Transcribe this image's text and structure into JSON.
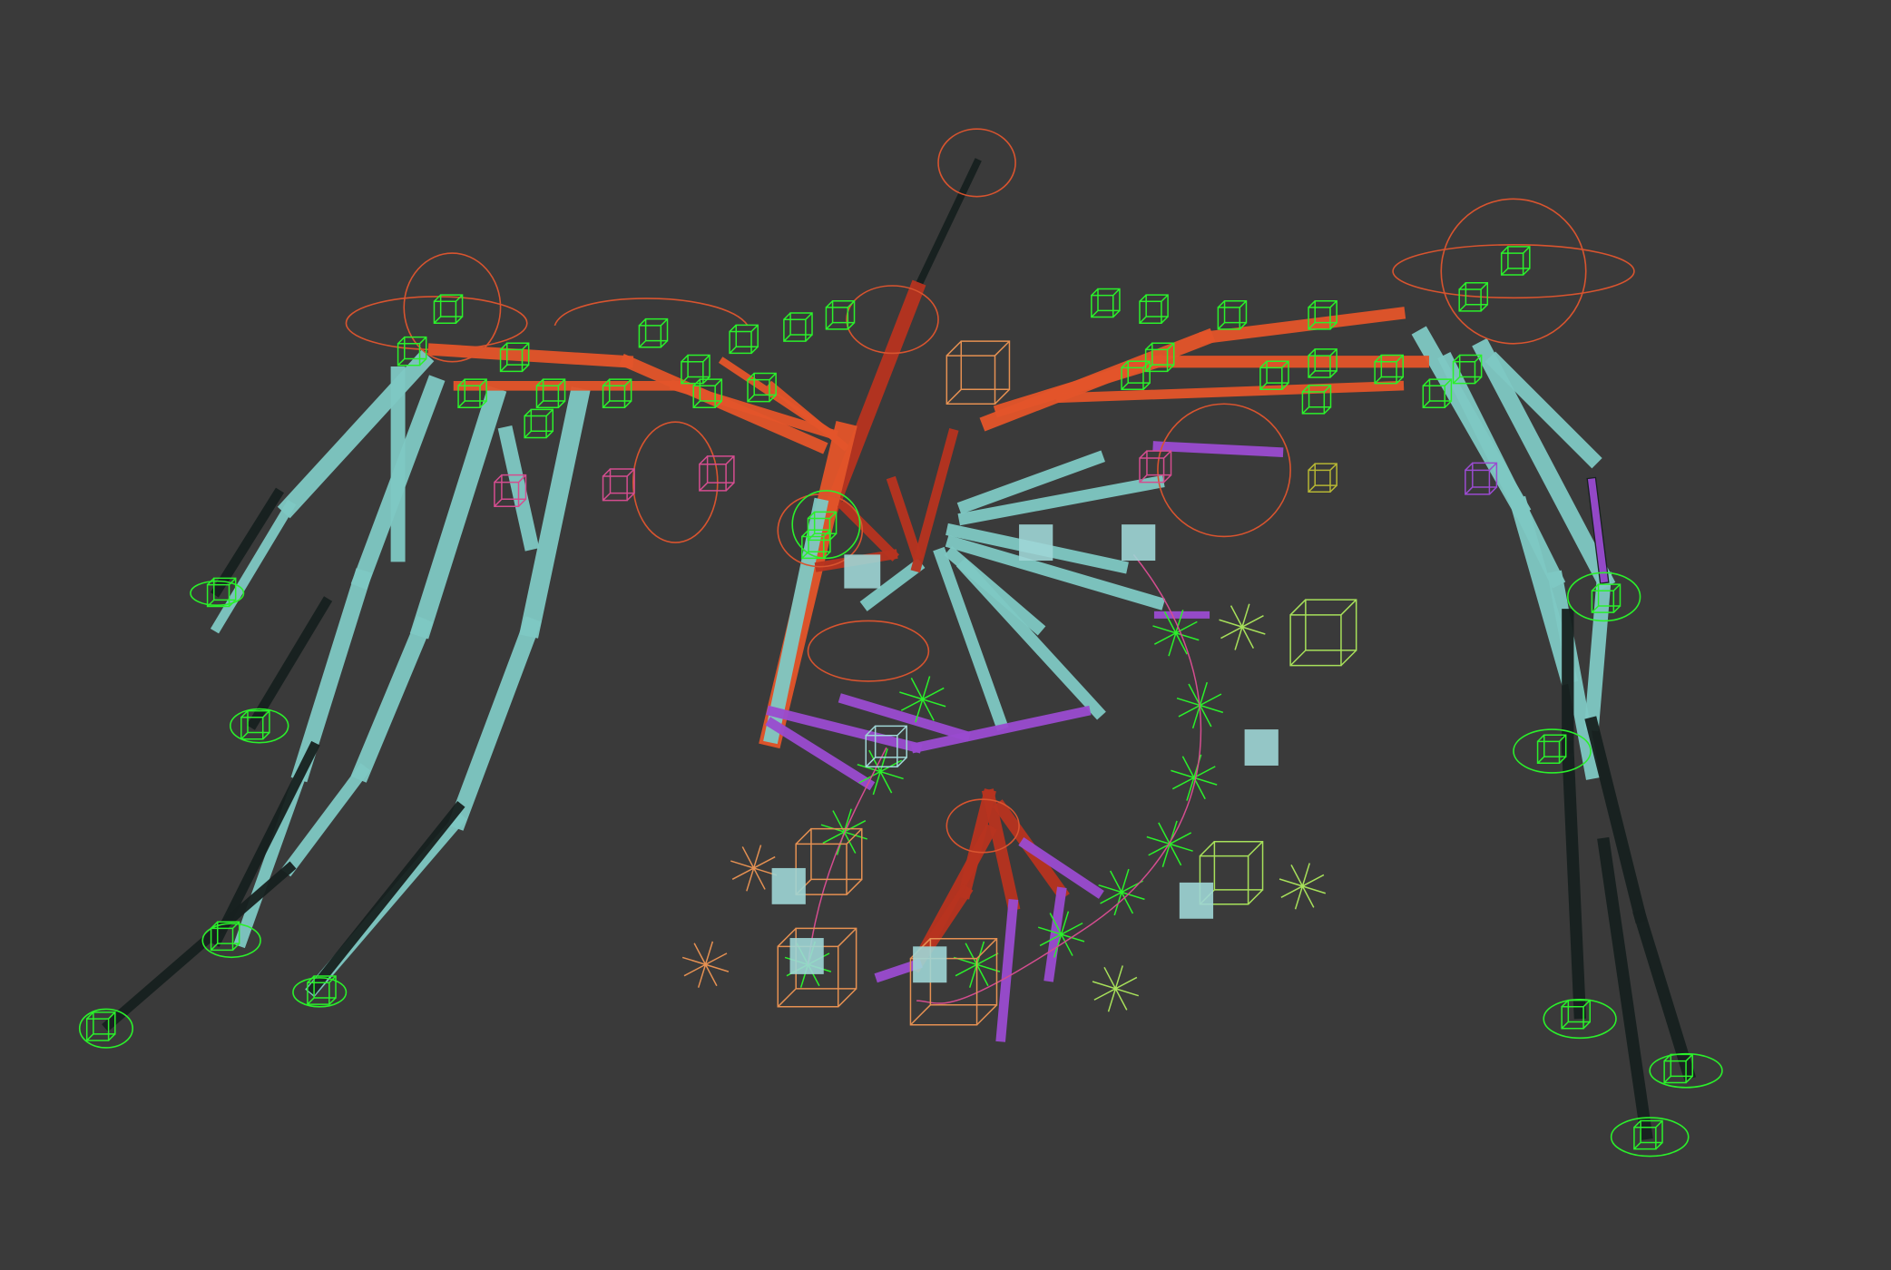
{
  "viewport": {
    "background": "#3a3a3a",
    "shading": "smooth-shaded",
    "colors": {
      "bone_cyan": "#7fc9c4",
      "bone_cyan_dark": "#5fa8a3",
      "bone_orange": "#e4552a",
      "bone_red": "#b8331f",
      "bone_dark": "#17201f",
      "bone_purple": "#9a4bd0",
      "control_green": "#2bf02b",
      "control_orange": "#d8542f",
      "helper_pink": "#d44d8f",
      "helper_lime": "#a7e05a",
      "helper_peach": "#e59052",
      "mesh_cyan": "#9fd6d6"
    }
  },
  "scene": {
    "subject": "winged-creature-rig",
    "icon": "bone-rig-icon"
  }
}
